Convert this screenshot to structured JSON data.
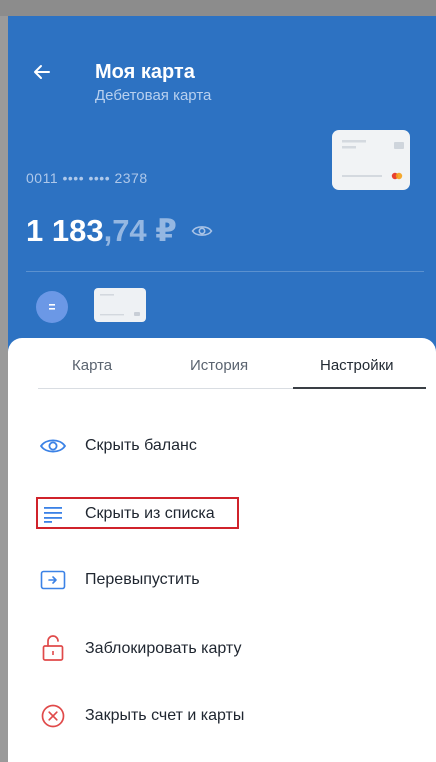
{
  "header": {
    "title": "Моя карта",
    "subtitle": "Дебетовая карта",
    "card_number": "0011  ••••  ••••  2378",
    "balance_main": "1 183",
    "balance_decimal": ",74 ₽",
    "back_icon": "arrow-left-icon",
    "eye_icon": "eye-icon"
  },
  "tabs": [
    {
      "label": "Карта"
    },
    {
      "label": "История"
    },
    {
      "label": "Настройки",
      "active": true
    }
  ],
  "menu": [
    {
      "label": "Скрыть баланс",
      "icon": "eye-icon"
    },
    {
      "label": "Скрыть из списка",
      "icon": "list-icon",
      "highlighted": true
    },
    {
      "label": "Перевыпустить",
      "icon": "reissue-arrow-icon"
    },
    {
      "label": "Заблокировать карту",
      "icon": "lock-icon"
    },
    {
      "label": "Закрыть счет и карты",
      "icon": "close-circle-icon"
    }
  ],
  "colors": {
    "header_bg": "#2d72c2",
    "accent_blue": "#3b82e6",
    "danger_red": "#e04a4a",
    "highlight_red": "#d0232b"
  }
}
